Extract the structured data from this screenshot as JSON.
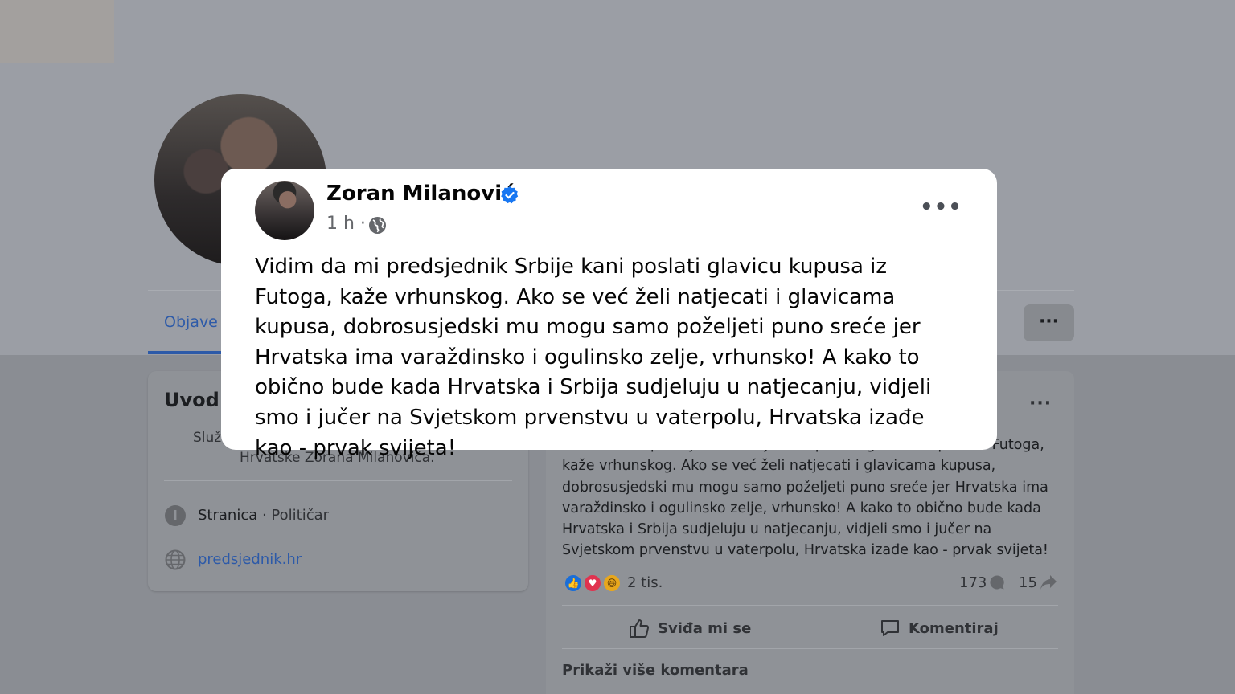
{
  "background": {
    "tab_label": "Objave",
    "intro": {
      "title": "Uvod",
      "description_line1": "Služ",
      "description_line2": "Hrvatske Zorana Milanovića.",
      "category_strong": "Stranica",
      "category_rest": " · Političar",
      "website": "predsjednik.hr"
    },
    "post": {
      "text": "Vidim da mi predsjednik Srbije kani poslati glavicu kupusa iz Futoga, kaže vrhunskog. Ako se već želi natjecati i glavicama kupusa, dobrosusjedski mu mogu samo poželjeti puno sreće jer Hrvatska ima varaždinsko i ogulinsko zelje, vrhunsko! A kako to obično bude kada Hrvatska i Srbija  sudjeluju u natjecanju, vidjeli smo i jučer na Svjetskom prvenstvu u vaterpolu, Hrvatska izađe kao - prvak svijeta!",
      "reaction_count": "2 tis.",
      "comment_count": "173",
      "share_count": "15",
      "like_label": "Sviđa mi se",
      "comment_label": "Komentiraj",
      "more_comments": "Prikaži više komentara"
    }
  },
  "overlay_post": {
    "author": "Zoran Milanović",
    "time": "1 h ·",
    "text": "Vidim da mi predsjednik Srbije kani poslati glavicu kupusa iz Futoga, kaže vrhunskog. Ako se već želi natjecati i glavicama kupusa, dobrosusjedski mu mogu samo poželjeti puno sreće jer Hrvatska ima varaždinsko i ogulinsko zelje, vrhunsko! A kako to obično bude kada Hrvatska i Srbija  sudjeluju u natjecanju, vidjeli smo i jučer na Svjetskom prvenstvu u vaterpolu, Hrvatska izađe kao - prvak svijeta!"
  },
  "icons": {
    "verified": "verified-badge-icon",
    "globe": "globe-icon",
    "more": "more-options-icon"
  },
  "colors": {
    "link_blue": "#2d5aa8",
    "verified_blue": "#1877f2"
  }
}
